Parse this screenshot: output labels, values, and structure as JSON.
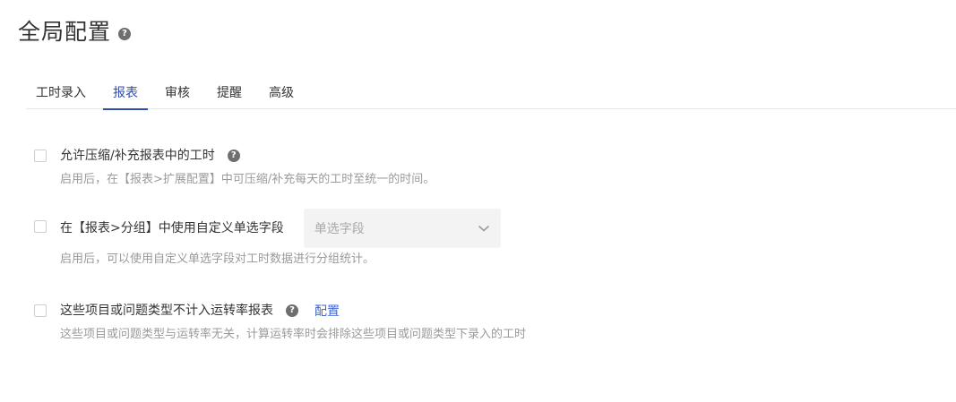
{
  "page": {
    "title": "全局配置"
  },
  "tabs": [
    {
      "label": "工时录入"
    },
    {
      "label": "报表",
      "active": true
    },
    {
      "label": "审核"
    },
    {
      "label": "提醒"
    },
    {
      "label": "高级"
    }
  ],
  "settings": [
    {
      "label": "允许压缩/补充报表中的工时",
      "description": "启用后，在【报表>扩展配置】中可压缩/补充每天的工时至统一的时间。",
      "checked": false
    },
    {
      "label": "在【报表>分组】中使用自定义单选字段",
      "description": "启用后，可以使用自定义单选字段对工时数据进行分组统计。",
      "checked": false,
      "select_placeholder": "单选字段"
    },
    {
      "label": "这些项目或问题类型不计入运转率报表",
      "description": "这些项目或问题类型与运转率无关，计算运转率时会排除这些项目或问题类型下录入的工时",
      "checked": false,
      "link": "配置"
    }
  ],
  "icons": {
    "help": "question-mark-circle",
    "select_arrow": "chevron-down"
  },
  "colors": {
    "accent": "#2d4db3",
    "link": "#3b66d8",
    "muted_text": "#9a9a9a"
  }
}
